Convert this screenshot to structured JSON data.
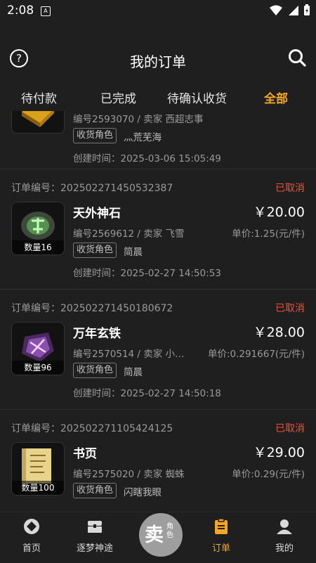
{
  "status_bar": {
    "time": "2:08",
    "notification_badge": "A"
  },
  "header": {
    "title": "我的订单",
    "help_symbol": "?"
  },
  "tabs": [
    {
      "label": "待付款",
      "active": false
    },
    {
      "label": "已完成",
      "active": false
    },
    {
      "label": "待确认收货",
      "active": false
    },
    {
      "label": "全部",
      "active": true
    }
  ],
  "orders": [
    {
      "order_no": "",
      "status": "",
      "item_name": "",
      "price": "",
      "meta": "编号2593070 / 卖家 西超志事",
      "unit_price": "",
      "qty_label": "",
      "role_tag": "收货角色",
      "role_name": "灬荒芜海",
      "created": "创建时间：2025-03-06 15:05:49",
      "icon": "gold-ingot-icon"
    },
    {
      "order_no": "订单编号：20250227145053238 7",
      "status": "已取消",
      "item_name": "天外神石",
      "price": "￥20.00",
      "meta": "编号2569612 / 卖家 飞雪",
      "unit_price": "单价:1.25(元/件)",
      "qty_label": "数量16",
      "role_tag": "收货角色",
      "role_name": "简晨",
      "created": "创建时间：2025-02-27 14:50:53",
      "icon": "green-rune-stone-icon"
    },
    {
      "order_no": "订单编号：20250227145018067 2",
      "status": "已取消",
      "item_name": "万年玄铁",
      "price": "￥28.00",
      "meta": "编号2570514 / 卖家 小…",
      "unit_price": "单价:0.291667(元/件)",
      "qty_label": "数量96",
      "role_tag": "收货角色",
      "role_name": "简晨",
      "created": "创建时间：2025-02-27 14:50:18",
      "icon": "purple-iron-ore-icon"
    },
    {
      "order_no": "订单编号：2025022711054241 25",
      "status": "已取消",
      "item_name": "书页",
      "price": "￥29.00",
      "meta": "编号2575020 / 卖家 蜘蛛",
      "unit_price": "单价:0.29(元/件)",
      "qty_label": "数量100",
      "role_tag": "收货角色",
      "role_name": "闪瞎我眼",
      "created": "",
      "icon": "book-page-icon"
    }
  ],
  "bottom_nav": [
    {
      "label": "首页",
      "icon": "home-diamond-icon",
      "active": false
    },
    {
      "label": "逐梦神途",
      "icon": "chest-icon",
      "active": false
    },
    {
      "label": "",
      "icon": "sell-button",
      "active": false
    },
    {
      "label": "订单",
      "icon": "clipboard-icon",
      "active": true
    },
    {
      "label": "我的",
      "icon": "user-icon",
      "active": false
    }
  ],
  "sell_button": {
    "main": "卖",
    "sub": "角色"
  },
  "colors": {
    "accent": "#f5a623",
    "cancelled": "#e6553a",
    "background": "#1f1f1f"
  }
}
